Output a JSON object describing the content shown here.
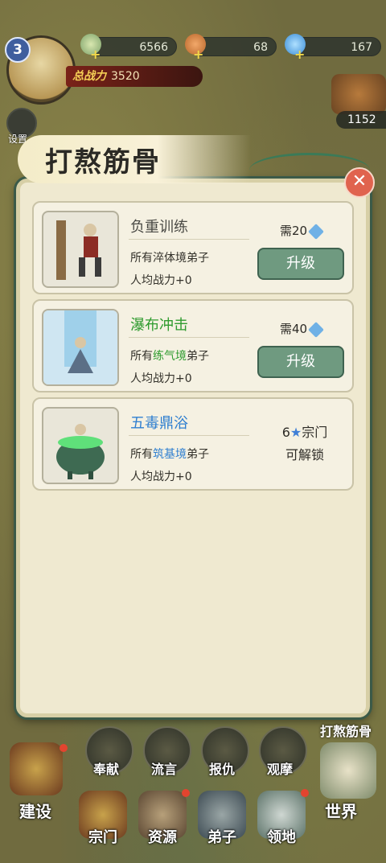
{
  "player": {
    "level": "3",
    "power_label": "总战力",
    "power_value": "3520"
  },
  "resources": [
    {
      "icon": "jade-coin-icon",
      "value": "6566"
    },
    {
      "icon": "peach-icon",
      "value": "68"
    },
    {
      "icon": "crystal-icon",
      "value": "167"
    }
  ],
  "settings_label": "设置",
  "right_counter": "1152",
  "modal": {
    "title": "打熬筋骨",
    "items": [
      {
        "name": "负重训练",
        "name_color": "#4a4a45",
        "desc_prefix": "所有",
        "desc_realm": "淬体境",
        "desc_suffix": "弟子",
        "realm_color": "#33312a",
        "effect": "人均战力+0",
        "cost": "需20",
        "button": "升级"
      },
      {
        "name": "瀑布冲击",
        "name_color": "#2f9b2f",
        "desc_prefix": "所有",
        "desc_realm": "练气境",
        "desc_suffix": "弟子",
        "realm_color": "#2f9b2f",
        "effect": "人均战力+0",
        "cost": "需40",
        "button": "升级"
      },
      {
        "name": "五毒鼎浴",
        "name_color": "#2f7fd0",
        "desc_prefix": "所有",
        "desc_realm": "筑基境",
        "desc_suffix": "弟子",
        "realm_color": "#2f7fd0",
        "effect": "人均战力+0",
        "unlock_count": "6",
        "unlock_unit": "宗门",
        "unlock_text": "可解锁"
      }
    ]
  },
  "side_tag": "打熬筋骨",
  "nav": {
    "top_row": [
      "奉献",
      "流言",
      "报仇",
      "观摩"
    ],
    "bottom_row": [
      "建设",
      "宗门",
      "资源",
      "弟子",
      "领地",
      "世界"
    ]
  }
}
